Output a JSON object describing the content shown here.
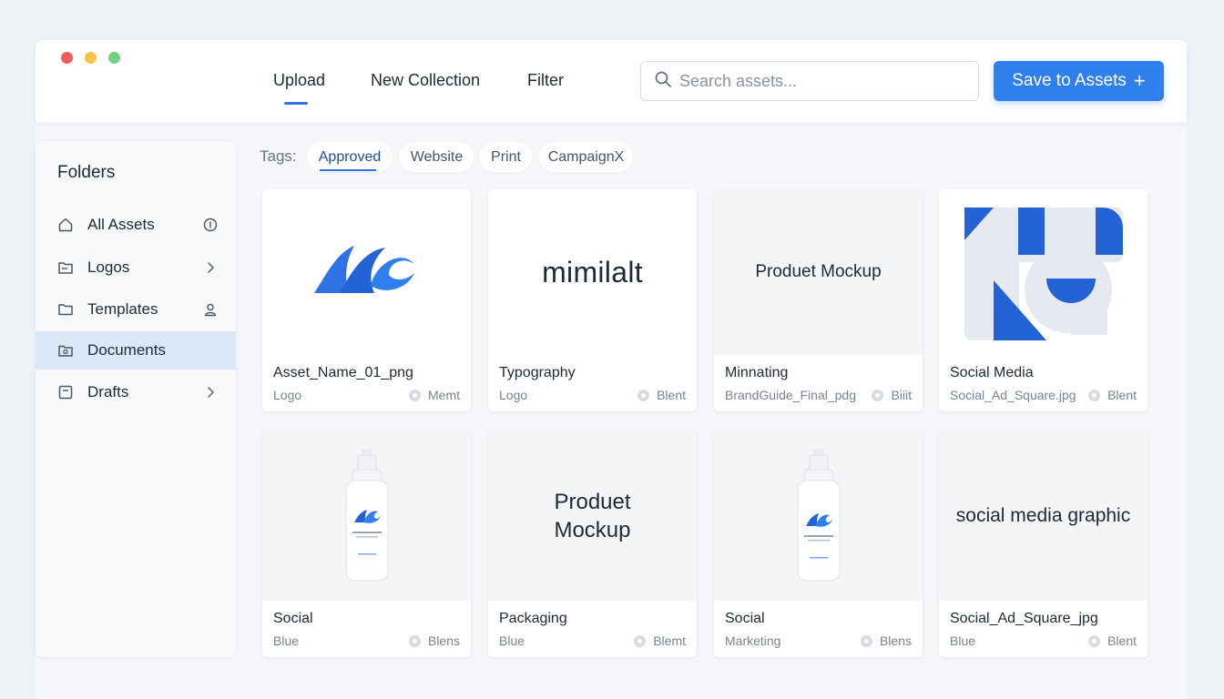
{
  "header": {
    "tabs": [
      {
        "label": "Upload",
        "active": true
      },
      {
        "label": "New Collection",
        "active": false
      },
      {
        "label": "Filter",
        "active": false
      }
    ],
    "search": {
      "placeholder": "Search assets..."
    },
    "save_button": {
      "label": "Save to Assets",
      "icon": "plus-icon"
    }
  },
  "sidebar": {
    "title": "Folders",
    "items": [
      {
        "label": "All Assets",
        "icon": "home-icon",
        "right_icon": "info-circle-icon",
        "active": false
      },
      {
        "label": "Logos",
        "icon": "folder-icon",
        "right_icon": "chevron-right-icon",
        "active": false
      },
      {
        "label": "Templates",
        "icon": "folder-outline-icon",
        "right_icon": "user-icon",
        "active": false
      },
      {
        "label": "Documents",
        "icon": "document-folder-icon",
        "right_icon": "",
        "active": true
      },
      {
        "label": "Drafts",
        "icon": "draft-icon",
        "right_icon": "chevron-right-icon",
        "active": false
      }
    ]
  },
  "tags": {
    "label": "Tags:",
    "items": [
      {
        "label": "Approved",
        "active": true
      },
      {
        "label": "Website",
        "active": false
      },
      {
        "label": "Print",
        "active": false
      },
      {
        "label": "CampaignX",
        "active": false
      }
    ]
  },
  "cards": [
    {
      "title": "Asset_Name_01_png",
      "left": "Logo",
      "right": "Memt",
      "thumb_type": "logo-waves",
      "thumb_text": ""
    },
    {
      "title": "Typography",
      "left": "Logo",
      "right": "Blent",
      "thumb_type": "text",
      "thumb_text": "mimilalt"
    },
    {
      "title": "Minnating",
      "left": "BrandGuide_Final_pdg",
      "right": "Biiit",
      "thumb_type": "text",
      "thumb_text": "Produet Mockup"
    },
    {
      "title": "Social Media",
      "left": "Social_Ad_Square.jpg",
      "right": "Blent",
      "thumb_type": "geometric",
      "thumb_text": ""
    },
    {
      "title": "Social",
      "left": "Blue",
      "right": "Blens",
      "thumb_type": "bottle",
      "thumb_text": ""
    },
    {
      "title": "Packaging",
      "left": "Blue",
      "right": "Blemt",
      "thumb_type": "text",
      "thumb_text": "Produet\nMockup"
    },
    {
      "title": "Social",
      "left": "Marketing",
      "right": "Blens",
      "thumb_type": "bottle",
      "thumb_text": ""
    },
    {
      "title": "Social_Ad_Square_jpg",
      "left": "Blue",
      "right": "Blent",
      "thumb_type": "text",
      "thumb_text": "social media graphic"
    }
  ],
  "colors": {
    "accent": "#2f80ed",
    "brand_blue": "#2463d6",
    "window_red": "#f15b5b",
    "window_yellow": "#f6c445",
    "window_green": "#71cf86"
  }
}
